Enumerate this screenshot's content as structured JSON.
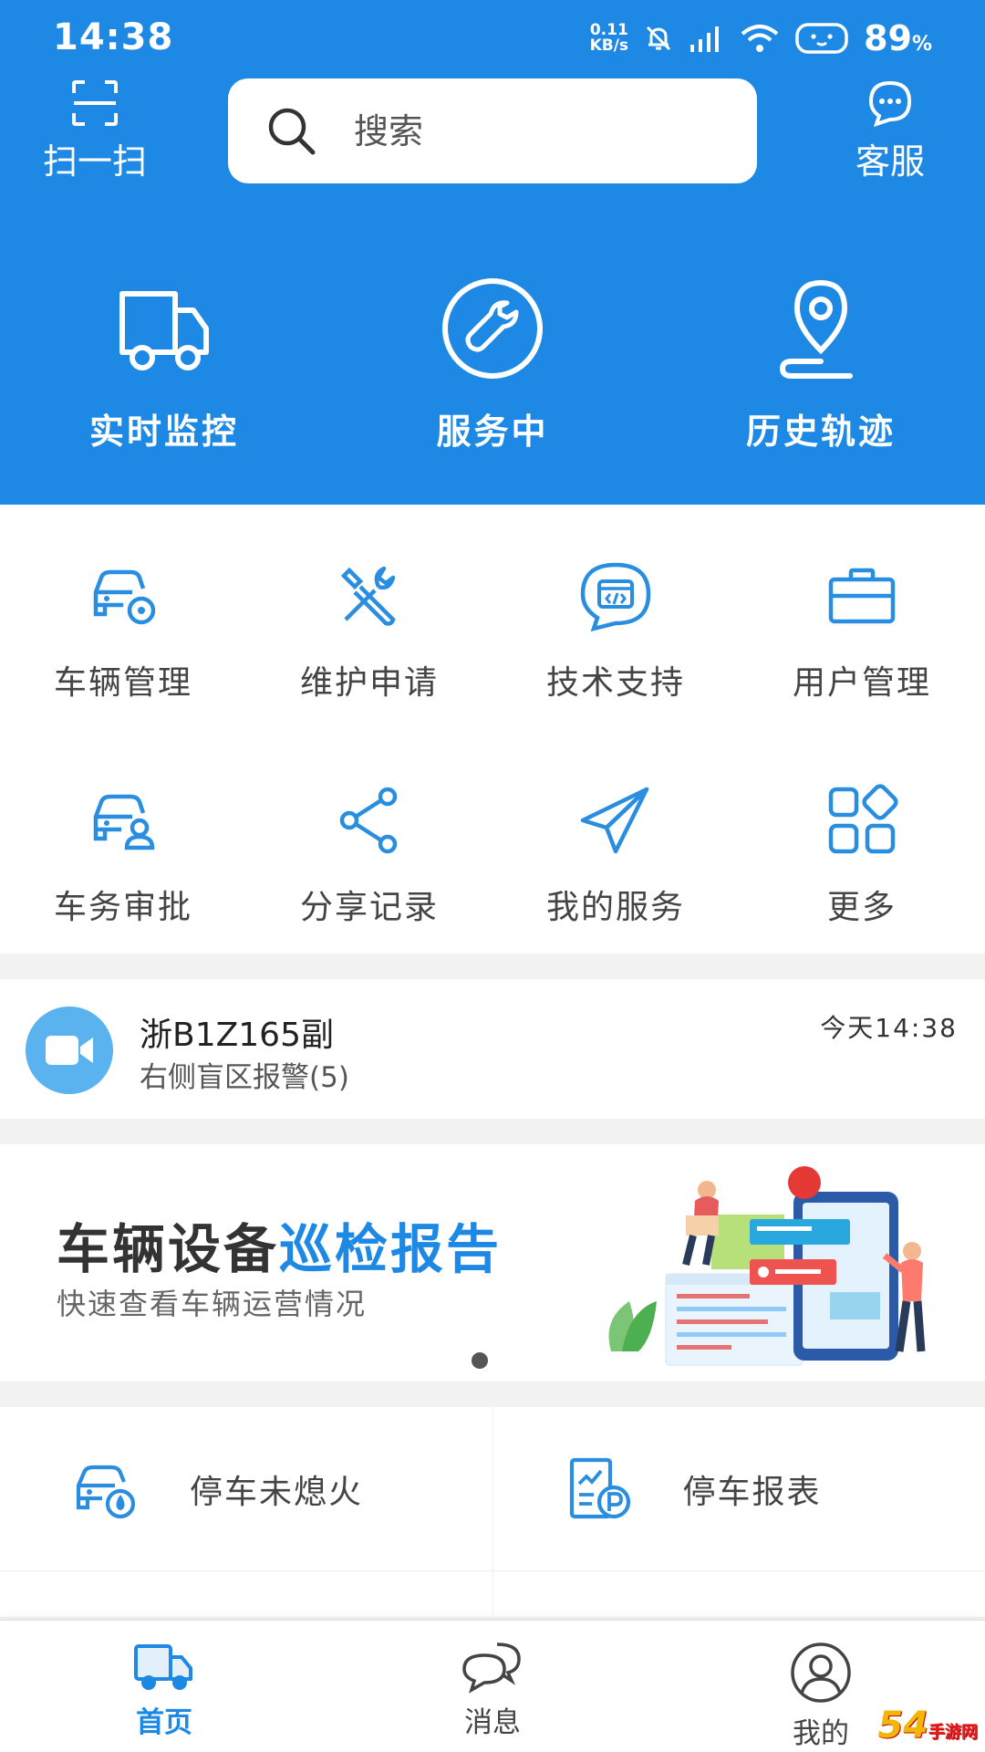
{
  "status_bar": {
    "time": "14:38",
    "net_speed_value": "0.11",
    "net_speed_unit": "KB/s",
    "battery": "89",
    "battery_unit": "%"
  },
  "header": {
    "scan_label": "扫一扫",
    "search_placeholder": "搜索",
    "service_label": "客服",
    "quick_actions": [
      {
        "label": "实时监控",
        "icon": "truck-icon"
      },
      {
        "label": "服务中",
        "icon": "wrench-icon"
      },
      {
        "label": "历史轨迹",
        "icon": "location-pin-icon"
      }
    ]
  },
  "grid": [
    {
      "label": "车辆管理",
      "icon": "car-gear-icon"
    },
    {
      "label": "维护申请",
      "icon": "tools-icon"
    },
    {
      "label": "技术支持",
      "icon": "code-chat-icon"
    },
    {
      "label": "用户管理",
      "icon": "briefcase-icon"
    },
    {
      "label": "车务审批",
      "icon": "car-user-icon"
    },
    {
      "label": "分享记录",
      "icon": "share-icon"
    },
    {
      "label": "我的服务",
      "icon": "paper-plane-icon"
    },
    {
      "label": "更多",
      "icon": "apps-icon"
    }
  ],
  "alert": {
    "plate": "浙B1Z165副",
    "message": "右侧盲区报警(5)",
    "time": "今天14:38"
  },
  "banner": {
    "title_part1": "车辆设备",
    "title_part2": "巡检报告",
    "subtitle": "快速查看车辆运营情况"
  },
  "reports": [
    {
      "label": "停车未熄火",
      "icon": "car-fire-icon"
    },
    {
      "label": "停车报表",
      "icon": "parking-report-icon"
    }
  ],
  "bottom_nav": [
    {
      "label": "首页",
      "icon": "truck-icon",
      "active": true
    },
    {
      "label": "消息",
      "icon": "chat-icon",
      "active": false
    },
    {
      "label": "我的",
      "icon": "user-icon",
      "active": false
    }
  ],
  "watermark": {
    "text": "54",
    "site": "手游网"
  },
  "colors": {
    "primary": "#1e88e5",
    "icon_blue": "#2a8ee0",
    "avatar_bg": "#5ab2ee"
  }
}
